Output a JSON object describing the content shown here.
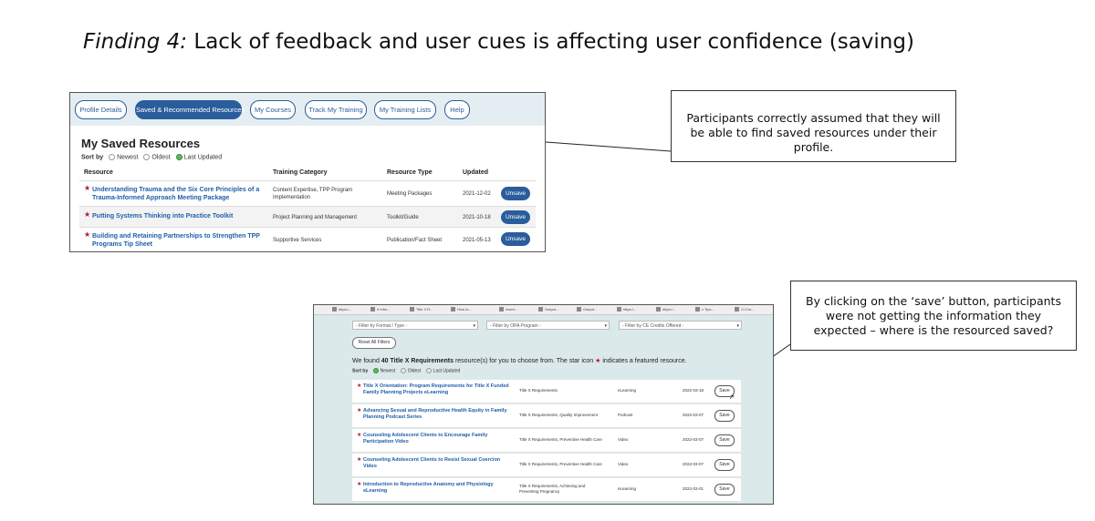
{
  "slide": {
    "title_italic": "Finding 4:",
    "title_rest": " Lack of feedback and user cues is affecting user confidence (saving)"
  },
  "callouts": [
    "Participants correctly assumed that they will be able to find saved resources under their profile.",
    "By clicking on the ‘save’ button, participants were not getting the information they expected – where is the resourced saved?"
  ],
  "saved_page": {
    "tabs": [
      "Profile Details",
      "Saved & Recommended Resources",
      "My Courses",
      "Track My Training",
      "My Training Lists",
      "Help"
    ],
    "active_tab": 1,
    "heading": "My Saved Resources",
    "sort_label": "Sort by",
    "sort_options": [
      "Newest",
      "Oldest",
      "Last Updated"
    ],
    "columns": [
      "Resource",
      "Training Category",
      "Resource Type",
      "Updated"
    ],
    "rows": [
      {
        "title": "Understanding Trauma and the Six Core Principles of a Trauma-Informed Approach Meeting Package",
        "category": "Content Expertise, TPP Program Implementation",
        "type": "Meeting Packages",
        "updated": "2021-12-02",
        "action": "Unsave"
      },
      {
        "title": "Putting Systems Thinking into Practice Toolkit",
        "category": "Project Planning and Management",
        "type": "Toolkit/Guide",
        "updated": "2021-10-18",
        "action": "Unsave"
      },
      {
        "title": "Building and Retaining Partnerships to Strengthen TPP Programs Tip Sheet",
        "category": "Supportive Services",
        "type": "Publication/Fact Sheet",
        "updated": "2021-05-13",
        "action": "Unsave"
      }
    ]
  },
  "search_page": {
    "browser_tabs": [
      "https:/...",
      "9 Infor...",
      "Title X R...",
      "How to...",
      "Insert...",
      "Output...",
      "Output...",
      "https:/...",
      "https:/...",
      "x Tips...",
      "Cl Cor..."
    ],
    "filters": [
      "- Filter by Format / Type -",
      "- Filter by OPA Program -",
      "- Filter by CE Credits Offered -"
    ],
    "reset_label": "Reset All Filters",
    "found_pre": "We found ",
    "found_bold": "40 Title X Requirements",
    "found_post": " resource(s) for you to choose from. The star icon ",
    "found_star": "★",
    "found_end": " indicates a featured resource.",
    "sort_label": "Sort by",
    "sort_options": [
      "Newest",
      "Oldest",
      "Last Updated"
    ],
    "results": [
      {
        "title": "Title X Orientation: Program Requirements for Title X Funded Family Planning Projects eLearning",
        "category": "Title X Requirements",
        "type": "eLearning",
        "date": "2022-03-18",
        "action": "Save"
      },
      {
        "title": "Advancing Sexual and Reproductive Health Equity in Family Planning Podcast Series",
        "category": "Title X Requirements, Quality Improvement",
        "type": "Podcast",
        "date": "2022-03-07",
        "action": "Save"
      },
      {
        "title": "Counseling Adolescent Clients to Encourage Family Participation Video",
        "category": "Title X Requirements, Preventive Health Care",
        "type": "Video",
        "date": "2022-03-07",
        "action": "Save"
      },
      {
        "title": "Counseling Adolescent Clients to Resist Sexual Coercion Video",
        "category": "Title X Requirements, Preventive Health Care",
        "type": "Video",
        "date": "2022-03-07",
        "action": "Save"
      },
      {
        "title": "Introduction to Reproductive Anatomy and Physiology eLearning",
        "category": "Title X Requirements, Achieving and Preventing Pregnancy",
        "type": "eLearning",
        "date": "2022-03-01",
        "action": "Save"
      }
    ]
  },
  "colors": {
    "primary": "#2a5d9c",
    "star": "#b01c2e",
    "tabbar_bg": "#e4eef2",
    "search_bg": "#dbe9ea"
  }
}
